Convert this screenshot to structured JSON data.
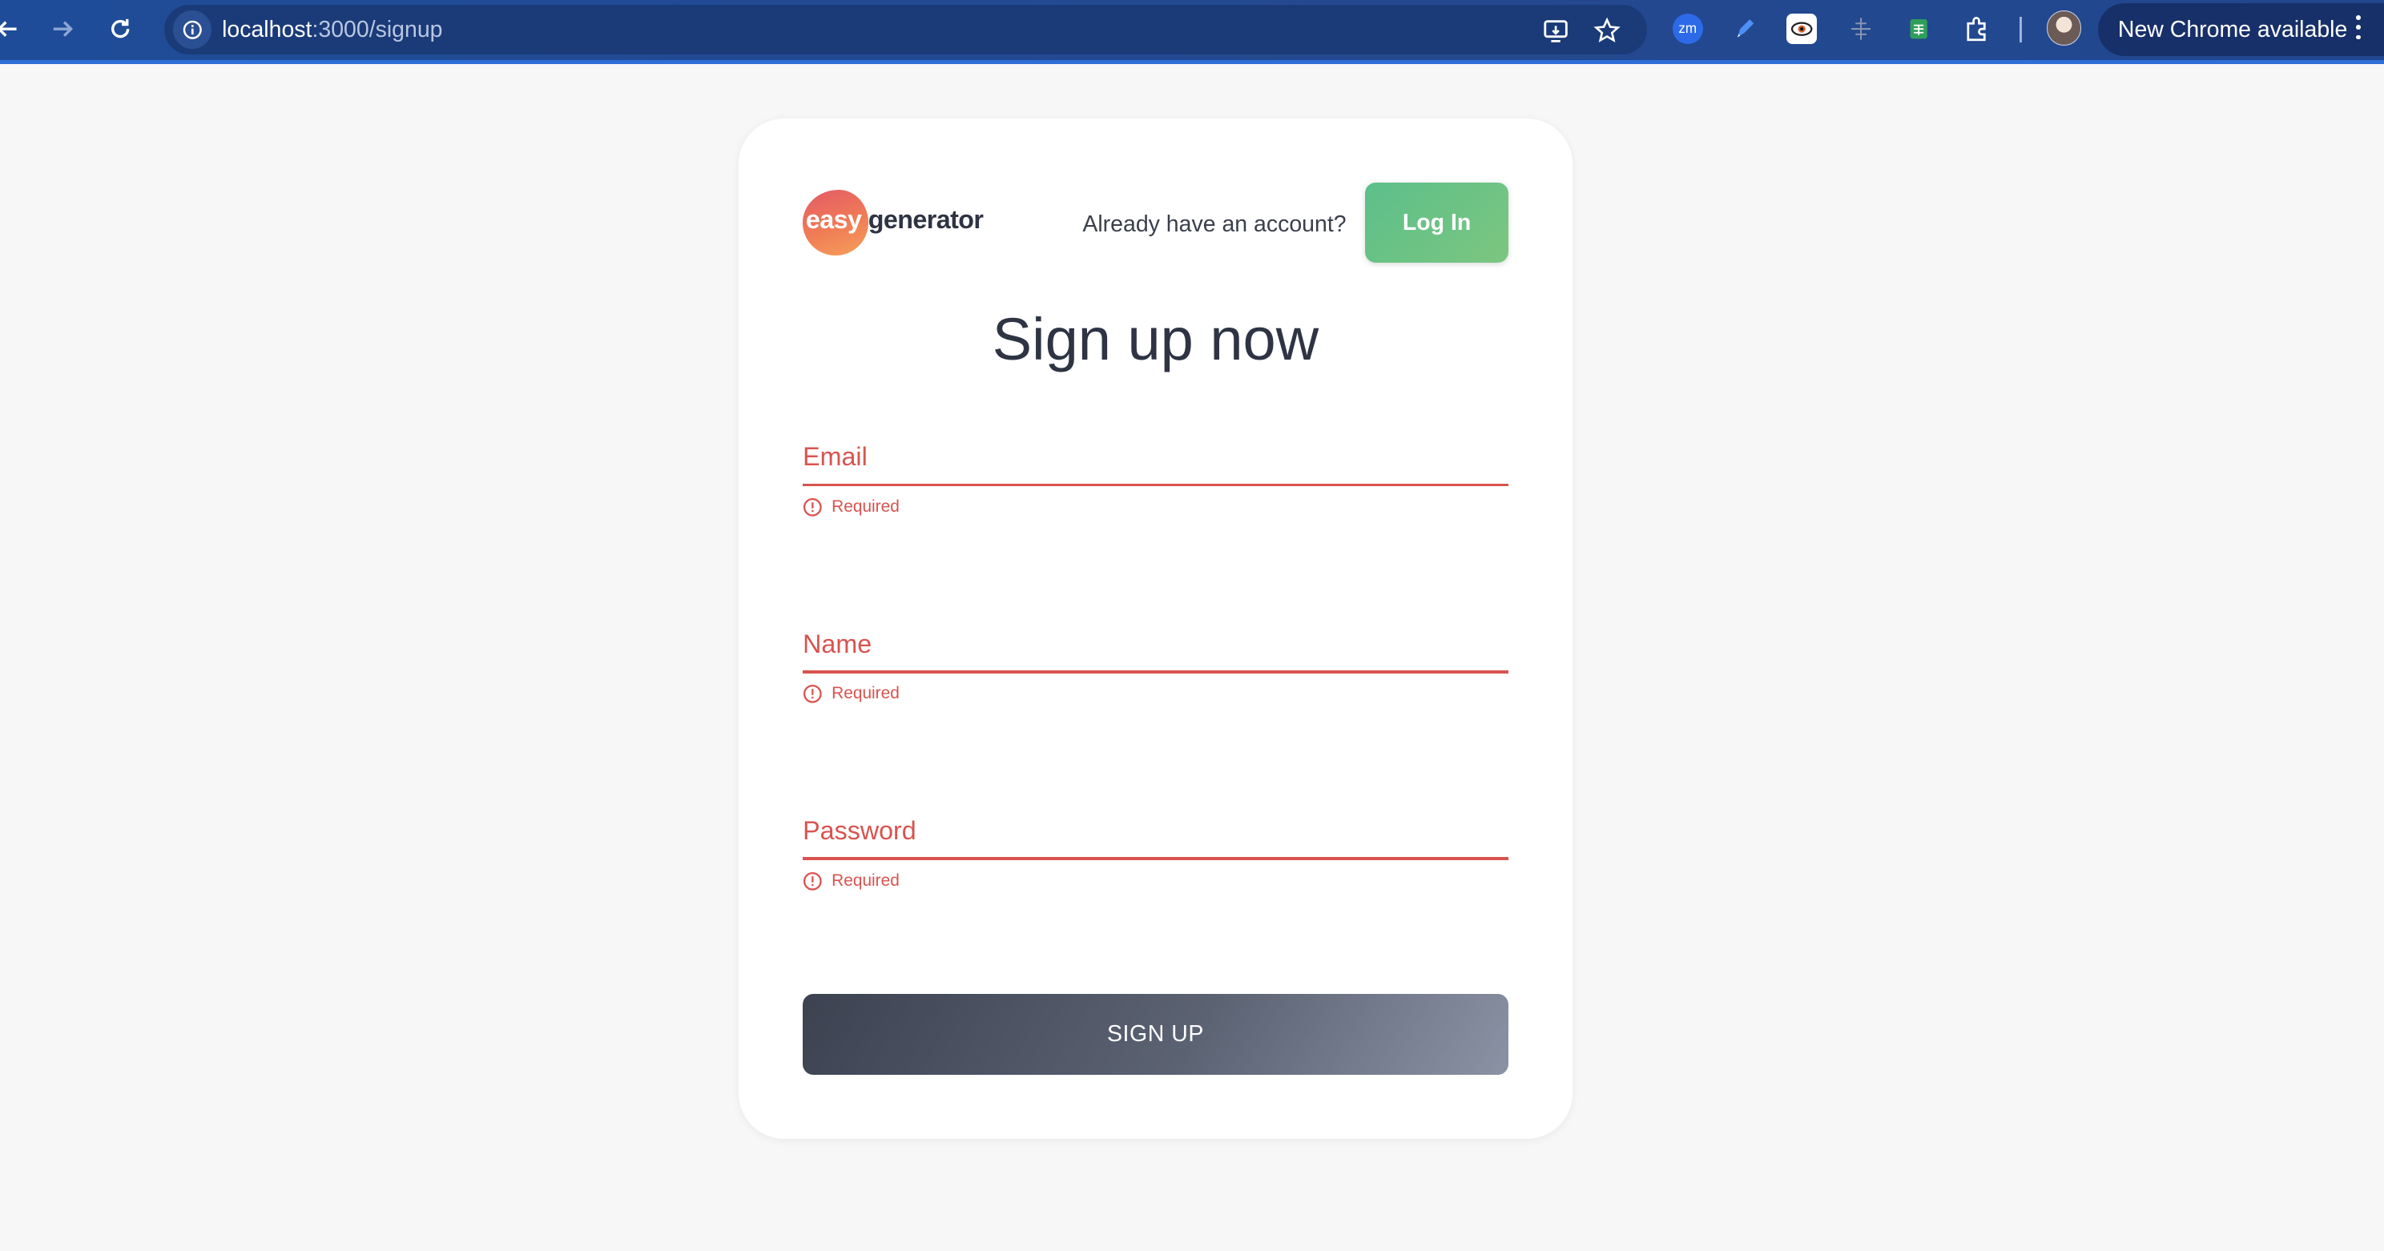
{
  "browser": {
    "url_host": "localhost",
    "url_path": ":3000/signup",
    "update_label": "New Chrome available",
    "extensions": [
      "zoom-icon",
      "pen-icon",
      "eye-icon",
      "ruler-icon",
      "sheets-icon",
      "puzzle-icon"
    ]
  },
  "header": {
    "logo_easy": "easy",
    "logo_generator": "generator",
    "account_prompt": "Already have an account?",
    "login_label": "Log In"
  },
  "form": {
    "title": "Sign up now",
    "fields": [
      {
        "label": "Email",
        "value": "",
        "error": "Required"
      },
      {
        "label": "Name",
        "value": "",
        "error": "Required"
      },
      {
        "label": "Password",
        "value": "",
        "error": "Required"
      }
    ],
    "submit_label": "SIGN UP"
  },
  "colors": {
    "browser_bar": "#1f4c98",
    "error": "#d9534f",
    "login_button": "#6cc285",
    "signup_button": "#4a5060",
    "brand_orange": "#f07c56"
  }
}
